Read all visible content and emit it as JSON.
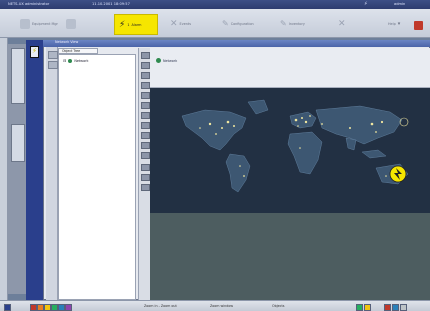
{
  "topbar": {
    "app": "NETS-UX  administrator",
    "datetime": "11.10.2001 18:09:57",
    "user": "admin"
  },
  "toolbar": {
    "items": [
      "Equipment Mgr",
      "Alarm",
      "Events",
      "Configuration",
      "Inventory",
      "Help"
    ],
    "alarm_count": "1"
  },
  "window": {
    "title": "Network View",
    "tree_header": "Object Tree",
    "tree_root": "Network",
    "map_label": "Network"
  },
  "status": {
    "zoom_text": "Zoom in - Zoom out",
    "mode_text": "Zoom window",
    "object_text": "Objects"
  },
  "colors": {
    "alarm_bg": "#f6e600",
    "nav_blue": "#2a3f8c",
    "map_land": "#4a6b8a",
    "lights": "#f0e6a0"
  }
}
